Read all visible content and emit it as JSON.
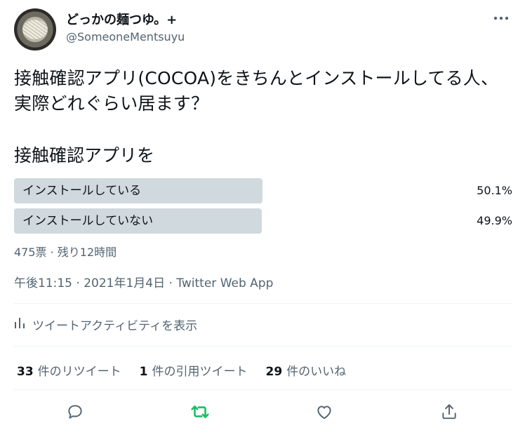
{
  "author": {
    "display_name": "どっかの麺つゆ。+",
    "handle": "@SomeoneMentsuyu"
  },
  "tweet": {
    "text": "接触確認アプリ(COCOA)をきちんとインストールしてる人、実際どれぐらい居ます？"
  },
  "poll": {
    "title": "接触確認アプリを",
    "options": [
      {
        "label": "インストールしている",
        "percent_text": "50.1%",
        "percent": 50.1
      },
      {
        "label": "インストールしていない",
        "percent_text": "49.9%",
        "percent": 49.9
      }
    ],
    "meta": "475票 · 残り12時間"
  },
  "timestamp": "午後11:15 · 2021年1月4日 · Twitter Web App",
  "activity_link": "ツイートアクティビティを表示",
  "stats": {
    "retweets_count": "33",
    "retweets_label": "件のリツイート",
    "quotes_count": "1",
    "quotes_label": "件の引用ツイート",
    "likes_count": "29",
    "likes_label": "件のいいね"
  },
  "colors": {
    "poll_bar": "#cfd9de",
    "secondary_text": "#536471",
    "retweet_green": "#17bf63"
  },
  "icons": [
    "more-icon",
    "analytics-icon",
    "reply-icon",
    "retweet-icon",
    "like-icon",
    "share-icon"
  ]
}
